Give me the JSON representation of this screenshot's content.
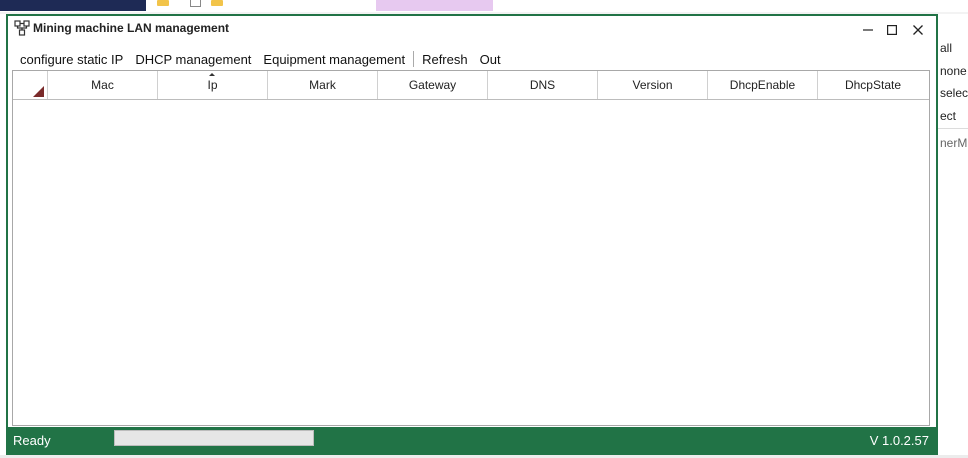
{
  "window": {
    "title": "Mining machine LAN management",
    "controls": {
      "minimize": "minimize",
      "maximize": "maximize",
      "close": "close"
    }
  },
  "menu": {
    "items": [
      "configure static IP",
      "DHCP management",
      "Equipment management",
      "Refresh",
      "Out"
    ]
  },
  "grid": {
    "columns": [
      "Mac",
      "Ip",
      "Mark",
      "Gateway",
      "DNS",
      "Version",
      "DhcpEnable",
      "DhcpState"
    ],
    "sorted_column": "Ip",
    "rows": []
  },
  "status": {
    "text": "Ready",
    "progress": 0,
    "version": "V 1.0.2.57"
  },
  "background": {
    "right_items": [
      "all",
      "none",
      "selecti",
      "ect",
      "nerMin"
    ]
  },
  "colors": {
    "accent": "#217346",
    "corner_marker": "#7a2a2a"
  }
}
